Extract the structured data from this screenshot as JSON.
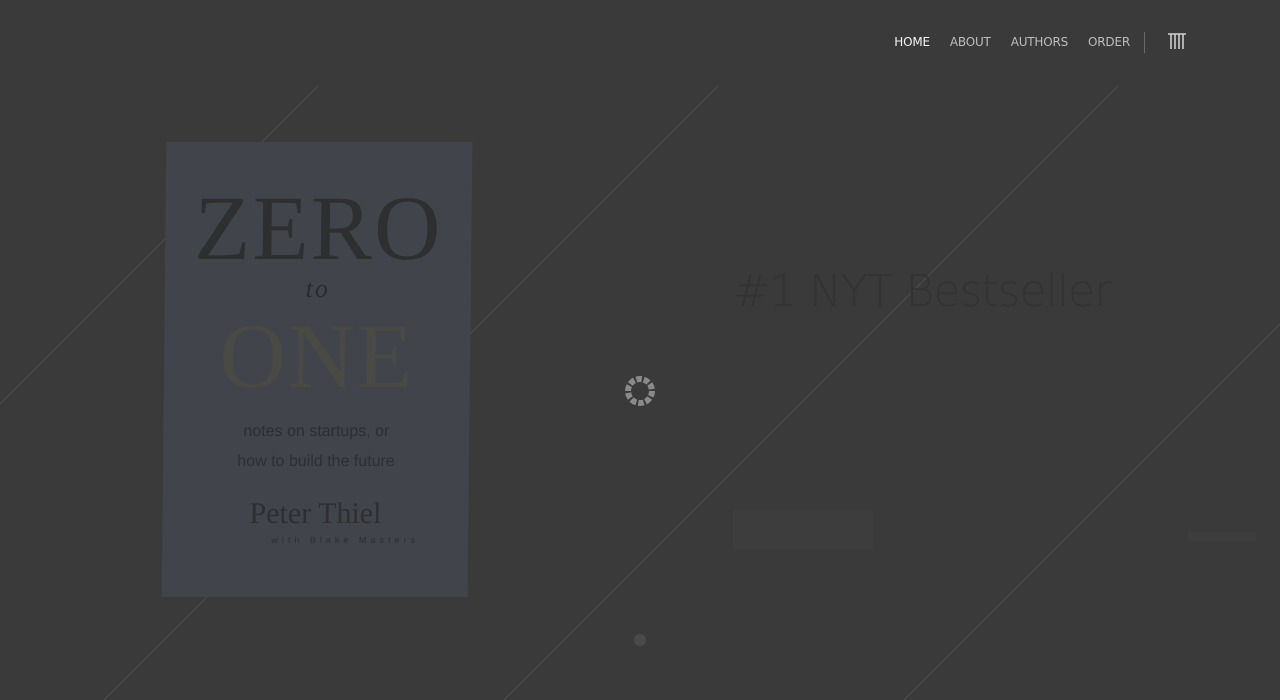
{
  "nav": {
    "items": [
      {
        "label": "HOME",
        "active": true
      },
      {
        "label": "ABOUT",
        "active": false
      },
      {
        "label": "AUTHORS",
        "active": false
      },
      {
        "label": "ORDER",
        "active": false
      }
    ],
    "logo_icon": "stylized-tt-logo-icon"
  },
  "book": {
    "title_line1": "ZERO",
    "title_line2": "to",
    "title_line3": "ONE",
    "subtitle_line1": "notes on startups, or",
    "subtitle_line2": "how to build the future",
    "author": "Peter Thiel",
    "coauthor": "with Blake Masters"
  },
  "hero": {
    "title": "#1 NYT Bestseller",
    "description": ""
  },
  "loader": {
    "icon": "loading-spinner-icon"
  },
  "colors": {
    "background": "#3a3a3a",
    "nav_text": "#bdbdbd",
    "nav_active": "#f2f2f2"
  }
}
